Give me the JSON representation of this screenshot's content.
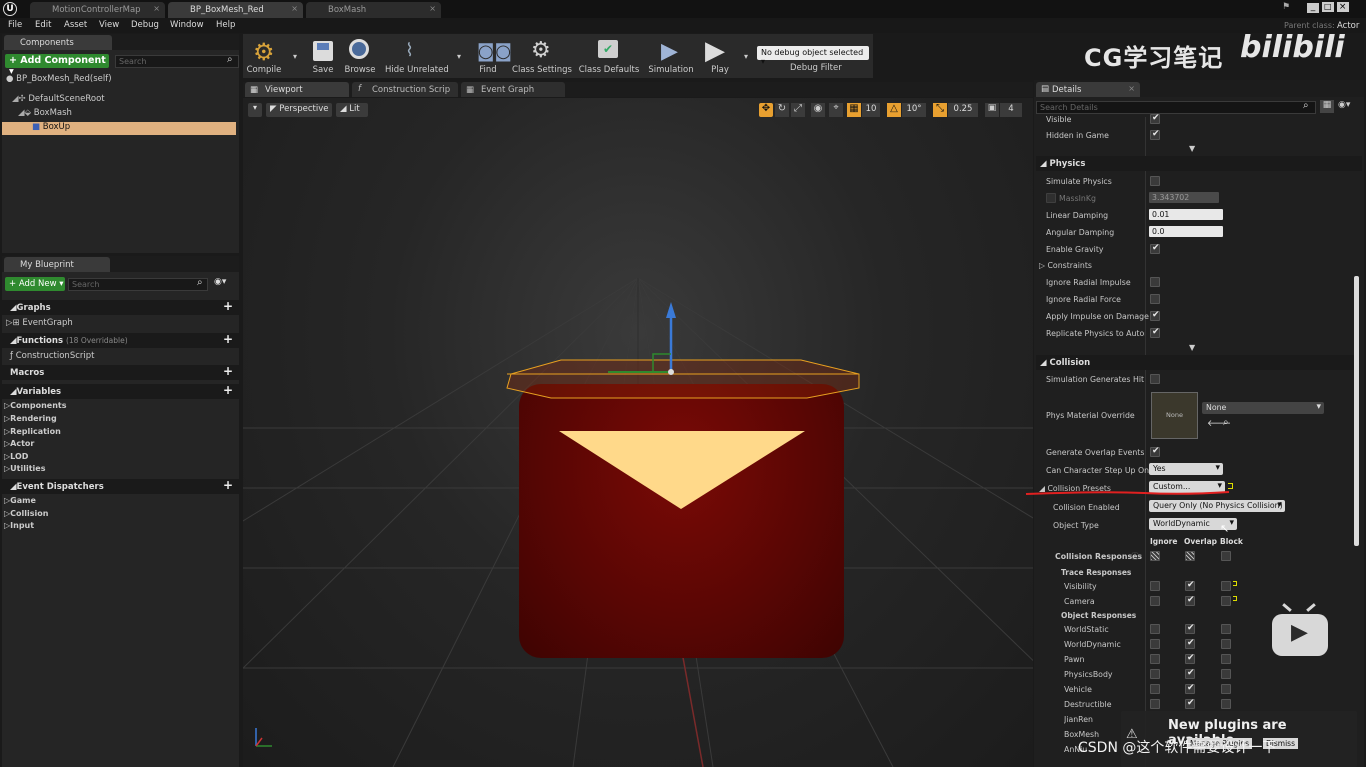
{
  "window": {
    "title_tabs": [
      "MotionControllerMap",
      "BP_BoxMesh_Red",
      "BoxMash"
    ],
    "parent_class_label": "Parent class:",
    "parent_class_value": "Actor"
  },
  "menu": [
    "File",
    "Edit",
    "Asset",
    "View",
    "Debug",
    "Window",
    "Help"
  ],
  "components_panel": {
    "tab": "Components",
    "add_button": "+ Add Component ▾",
    "search_placeholder": "Search",
    "items": [
      "BP_BoxMesh_Red(self)",
      "DefaultSceneRoot",
      "BoxMash",
      "BoxUp"
    ]
  },
  "blueprint_panel": {
    "tab": "My Blueprint",
    "add_button": "+ Add New ▾",
    "search_placeholder": "Search",
    "sections": {
      "graphs": "Graphs",
      "event_graph": "EventGraph",
      "functions": "Functions",
      "functions_count": "(18 Overridable)",
      "construction": "ConstructionScript",
      "macros": "Macros",
      "variables": "Variables",
      "var_items": [
        "Components",
        "Rendering",
        "Replication",
        "Actor",
        "LOD",
        "Utilities"
      ],
      "dispatchers": "Event Dispatchers",
      "disp_items": [
        "Game",
        "Collision",
        "Input"
      ]
    }
  },
  "toolbar": {
    "buttons": [
      "Compile",
      "Save",
      "Browse",
      "Hide Unrelated",
      "Find",
      "Class Settings",
      "Class Defaults",
      "Simulation",
      "Play"
    ],
    "debug_select": "No debug object selected ▾",
    "debug_filter": "Debug Filter"
  },
  "editor_tabs": [
    "Viewport",
    "Construction Scrip",
    "Event Graph"
  ],
  "viewport": {
    "perspective": "Perspective",
    "lit": "Lit",
    "grid_snap": "10",
    "rot_snap": "10°",
    "scale_snap": "0.25",
    "cam_speed": "4"
  },
  "watermark": {
    "text": "CG学习笔记",
    "brand": "bilibili",
    "csdn": "CSDN @这个软件需要设计一下"
  },
  "details": {
    "tab": "Details",
    "search_placeholder": "Search Details",
    "top_rows": [
      {
        "label": "Visible",
        "checked": true
      },
      {
        "label": "Hidden in Game",
        "checked": true
      }
    ],
    "physics_header": "Physics",
    "physics_rows": [
      {
        "label": "Simulate Physics",
        "type": "cb",
        "checked": false
      },
      {
        "label": "MassInKg",
        "type": "field",
        "value": "3.343702",
        "disabled": true
      },
      {
        "label": "Linear Damping",
        "type": "field",
        "value": "0.01"
      },
      {
        "label": "Angular Damping",
        "type": "field",
        "value": "0.0"
      },
      {
        "label": "Enable Gravity",
        "type": "cb",
        "checked": true
      },
      {
        "label": "Constraints",
        "type": "group"
      },
      {
        "label": "Ignore Radial Impulse",
        "type": "cb",
        "checked": false
      },
      {
        "label": "Ignore Radial Force",
        "type": "cb",
        "checked": false
      },
      {
        "label": "Apply Impulse on Damage",
        "type": "cb",
        "checked": true
      },
      {
        "label": "Replicate Physics to Autono",
        "type": "cb",
        "checked": true
      }
    ],
    "collision_header": "Collision",
    "sim_hit": "Simulation Generates Hit Ev",
    "phys_mat": "Phys Material Override",
    "phys_mat_thumb": "None",
    "phys_mat_value": "None",
    "gen_overlap": "Generate Overlap Events",
    "step_up": "Can Character Step Up On",
    "step_up_value": "Yes",
    "presets": "Collision Presets",
    "presets_value": "Custom...",
    "enabled": "Collision Enabled",
    "enabled_value": "Query Only (No Physics Collision)",
    "object_type": "Object Type",
    "object_type_value": "WorldDynamic",
    "col_heads": [
      "Ignore",
      "Overlap",
      "Block"
    ],
    "responses": "Collision Responses",
    "trace": "Trace Responses",
    "trace_rows": [
      "Visibility",
      "Camera"
    ],
    "object": "Object Responses",
    "object_rows": [
      "WorldStatic",
      "WorldDynamic",
      "Pawn",
      "PhysicsBody",
      "Vehicle",
      "Destructible",
      "JianRen",
      "BoxMesh",
      "AnNiu"
    ]
  },
  "notification": {
    "text": "New plugins are available",
    "manage": "Manage Plugins",
    "dismiss": "Dismiss"
  }
}
